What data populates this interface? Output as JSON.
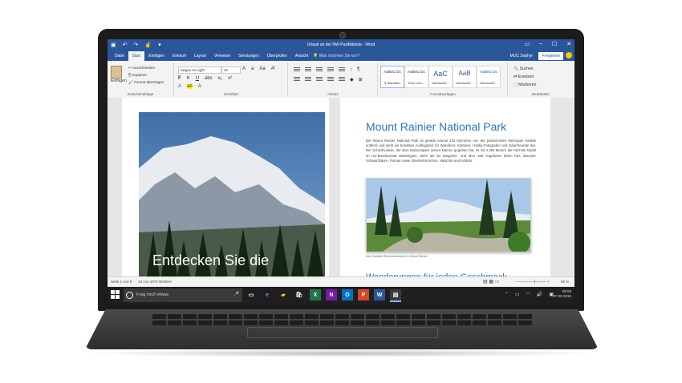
{
  "window": {
    "title": "Urlaub an der NW-Pazifikküste - Word",
    "user": "MUC Zephyr",
    "share_label": "Freigeben"
  },
  "tabs": [
    "Datei",
    "Start",
    "Einfügen",
    "Entwurf",
    "Layout",
    "Verweise",
    "Sendungen",
    "Überprüfen",
    "Ansicht"
  ],
  "tell_me": "Was möchten Sie tun?",
  "ribbon": {
    "clipboard": {
      "paste": "Einfügen",
      "cut": "Ausschneiden",
      "copy": "Kopieren",
      "format_painter": "Format übertragen",
      "label": "Zwischenablage"
    },
    "font": {
      "name": "Segoe UI Light",
      "size": "12",
      "label": "Schriftart",
      "bold": "F",
      "italic": "K",
      "underline": "U"
    },
    "paragraph": {
      "label": "Absatz"
    },
    "styles": {
      "items": [
        {
          "preview": "AaBbCcDc",
          "name": "¶ Standard"
        },
        {
          "preview": "AaBbCcDc",
          "name": "Kein Leer..."
        },
        {
          "preview": "AaC",
          "name": "Überschrif..."
        },
        {
          "preview": "AaB",
          "name": "Überschrif..."
        },
        {
          "preview": "AaBbCcDc",
          "name": "Überschrif..."
        }
      ],
      "label": "Formatvorlagen"
    },
    "editing": {
      "find": "Suchen",
      "replace": "Ersetzen",
      "select": "Markieren",
      "label": "Bearbeiten"
    }
  },
  "document": {
    "left_overlay": "Entdecken Sie die",
    "heading": "Mount Rainier National Park",
    "body": "Der Mount Rainier National Park ist gerade einmal 140 Kilometer von der pulsierenden Metropole Seattle entfernt und stellt ein beliebtes Ausflugsziel für Wanderer, Kletterer, Hobby-Fotografen und Naturfreunde dar. Der Schichtvulkan, der dem Nationalpark seinen Namen gegeben hat, ist mit 4.392 Metern der höchste Gipfel im US-Bundesstaat Washington. Mehr als 50 Säugetier- und über 180 Vogelarten leben hier, darunter Schwarzbären, Pumas sowie Streifenhörnchen, Habichte und Kolibris.",
    "caption": "Das Paradise Besucherzentrum im Mount Rainier",
    "subheading": "Wanderungen für jeden Geschmack"
  },
  "status": {
    "page": "Seite 1 von 6",
    "words": "13 von 1070 Wörtern",
    "zoom": "90 %"
  },
  "taskbar": {
    "search_placeholder": "Frag mich etwas",
    "time": "08:58",
    "date": "07.08.2015"
  },
  "colors": {
    "word_blue": "#2b579a",
    "heading_blue": "#2e74b5",
    "taskbar": "#1f1f1f"
  }
}
